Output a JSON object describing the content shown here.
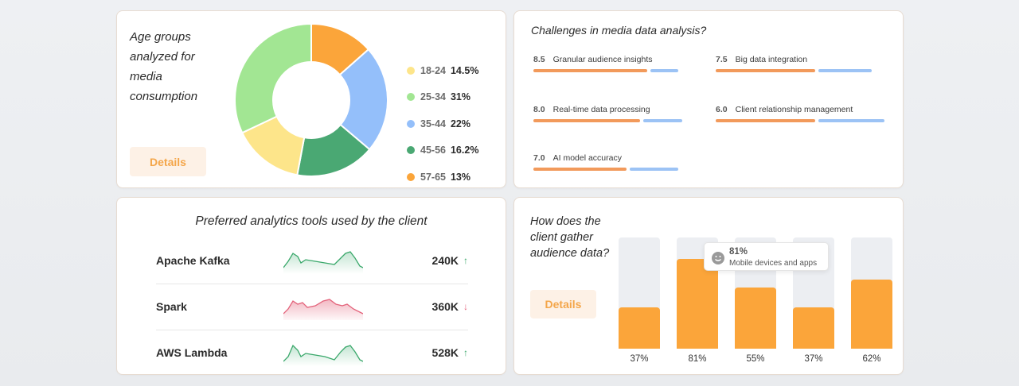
{
  "age_card": {
    "title": "Age groups analyzed for media consumption",
    "details_label": "Details",
    "segments": [
      {
        "range": "18-24",
        "pct_label": "14.5%",
        "value": 14.5,
        "color": "#fde58a"
      },
      {
        "range": "25-34",
        "pct_label": "31%",
        "value": 31,
        "color": "#a2e693"
      },
      {
        "range": "35-44",
        "pct_label": "22%",
        "value": 22,
        "color": "#94bffa"
      },
      {
        "range": "45-56",
        "pct_label": "16.2%",
        "value": 16.2,
        "color": "#4aa873"
      },
      {
        "range": "57-65",
        "pct_label": "13%",
        "value": 13,
        "color": "#fba53a"
      }
    ]
  },
  "challenges_card": {
    "title": "Challenges in media data analysis?",
    "items": [
      {
        "score": "8.5",
        "label": "Granular audience insights",
        "orange": 8.5,
        "blue": 2.0
      },
      {
        "score": "7.5",
        "label": "Big data integration",
        "orange": 7.5,
        "blue": 3.8
      },
      {
        "score": "8.0",
        "label": "Real-time data processing",
        "orange": 8.0,
        "blue": 2.8
      },
      {
        "score": "6.0",
        "label": "Client relationship management",
        "orange": 7.5,
        "blue": 4.7
      },
      {
        "score": "7.0",
        "label": "AI model accuracy",
        "orange": 7.0,
        "blue": 3.5
      }
    ]
  },
  "tools_card": {
    "title": "Preferred analytics tools used by the client",
    "tools": [
      {
        "name": "Apache Kafka",
        "value": "240K",
        "arrow": "↑",
        "trend": "up",
        "color": "#3aa86b"
      },
      {
        "name": "Spark",
        "value": "360K",
        "arrow": "↓",
        "trend": "down",
        "color": "#e3627a"
      },
      {
        "name": "AWS Lambda",
        "value": "528K",
        "arrow": "↑",
        "trend": "up",
        "color": "#3aa86b"
      }
    ]
  },
  "gather_card": {
    "title": "How does the client gather audience data?",
    "details_label": "Details",
    "bars": [
      {
        "label": "37%",
        "value": 37
      },
      {
        "label": "81%",
        "value": 81
      },
      {
        "label": "55%",
        "value": 55
      },
      {
        "label": "37%",
        "value": 37
      },
      {
        "label": "62%",
        "value": 62
      }
    ],
    "tooltip": {
      "pct": "81%",
      "desc": "Mobile devices and apps",
      "icon": "smile-icon"
    }
  }
}
